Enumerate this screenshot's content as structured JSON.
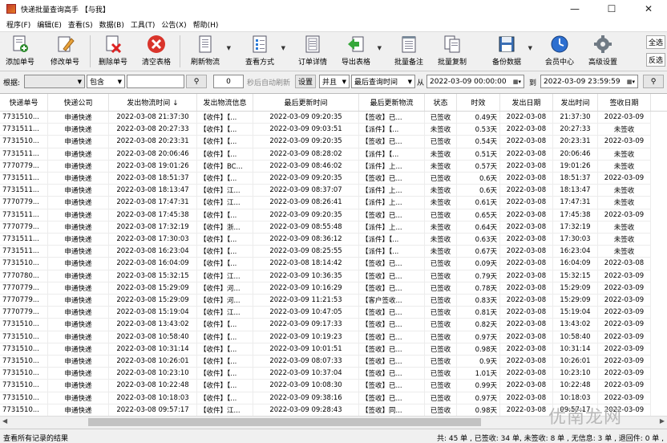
{
  "window": {
    "title": "快递批量查询高手 【与我】",
    "minimize": "—",
    "maximize": "☐",
    "close": "✕"
  },
  "menu": [
    "程序(F)",
    "编辑(E)",
    "查看(S)",
    "数据(B)",
    "工具(T)",
    "公告(X)",
    "帮助(H)"
  ],
  "toolbar": {
    "add": "添加单号",
    "edit": "修改单号",
    "delete": "删除单号",
    "clear": "清空表格",
    "refresh": "刷新物流",
    "view": "查看方式",
    "detail": "订单详情",
    "export": "导出表格",
    "remark": "批量备注",
    "copy": "批量复制",
    "backup": "备份数据",
    "member": "会员中心",
    "settings": "高级设置",
    "select_all": "全选",
    "invert": "反选"
  },
  "filter": {
    "by_label": "根据:",
    "by_value": "",
    "mode_value": "包含",
    "keyword": "",
    "interval": "0",
    "auto_refresh_label": "秒后自动刷新",
    "set_btn": "设置",
    "logic_value": "并且",
    "field_value": "最后查询时间",
    "from_label": "从",
    "from_value": "2022-03-09 00:00:00",
    "to_label": "到",
    "to_value": "2022-03-09 23:59:59"
  },
  "columns": [
    "快递单号",
    "快递公司",
    "发出物流时间 ↓",
    "发出物流信息",
    "最后更新时间",
    "最后更新物流",
    "状态",
    "时效",
    "发出日期",
    "发出时间",
    "签收日期"
  ],
  "rows": [
    [
      "7731510...",
      "申通快递",
      "2022-03-08 21:37:30",
      "【收件】【...",
      "2022-03-09 09:20:35",
      "【签收】已...",
      "已签收",
      "0.49天",
      "2022-03-08",
      "21:37:30",
      "2022-03-09"
    ],
    [
      "7731511...",
      "申通快递",
      "2022-03-08 20:27:33",
      "【收件】【...",
      "2022-03-09 09:03:51",
      "【派件】【...",
      "未签收",
      "0.53天",
      "2022-03-08",
      "20:27:33",
      "未签收"
    ],
    [
      "7731510...",
      "申通快递",
      "2022-03-08 20:23:31",
      "【收件】【...",
      "2022-03-09 09:20:35",
      "【签收】已...",
      "已签收",
      "0.54天",
      "2022-03-08",
      "20:23:31",
      "2022-03-09"
    ],
    [
      "7731511...",
      "申通快递",
      "2022-03-08 20:06:46",
      "【收件】【...",
      "2022-03-09 08:28:02",
      "【派件】【...",
      "未签收",
      "0.51天",
      "2022-03-08",
      "20:06:46",
      "未签收"
    ],
    [
      "7770779...",
      "申通快递",
      "2022-03-08 19:01:26",
      "【收件】BC...",
      "2022-03-09 08:46:02",
      "【派件】上...",
      "未签收",
      "0.57天",
      "2022-03-08",
      "19:01:26",
      "未签收"
    ],
    [
      "7731511...",
      "申通快递",
      "2022-03-08 18:51:37",
      "【收件】【...",
      "2022-03-09 09:20:35",
      "【签收】已...",
      "已签收",
      "0.6天",
      "2022-03-08",
      "18:51:37",
      "2022-03-09"
    ],
    [
      "7731511...",
      "申通快递",
      "2022-03-08 18:13:47",
      "【收件】江...",
      "2022-03-09 08:37:07",
      "【派件】上...",
      "未签收",
      "0.6天",
      "2022-03-08",
      "18:13:47",
      "未签收"
    ],
    [
      "7770779...",
      "申通快递",
      "2022-03-08 17:47:31",
      "【收件】江...",
      "2022-03-09 08:26:41",
      "【派件】上...",
      "未签收",
      "0.61天",
      "2022-03-08",
      "17:47:31",
      "未签收"
    ],
    [
      "7731511...",
      "申通快递",
      "2022-03-08 17:45:38",
      "【收件】【...",
      "2022-03-09 09:20:35",
      "【签收】已...",
      "已签收",
      "0.65天",
      "2022-03-08",
      "17:45:38",
      "2022-03-09"
    ],
    [
      "7770779...",
      "申通快递",
      "2022-03-08 17:32:19",
      "【收件】浙...",
      "2022-03-09 08:55:48",
      "【派件】上...",
      "未签收",
      "0.64天",
      "2022-03-08",
      "17:32:19",
      "未签收"
    ],
    [
      "7731511...",
      "申通快递",
      "2022-03-08 17:30:03",
      "【收件】【...",
      "2022-03-09 08:36:12",
      "【派件】【...",
      "未签收",
      "0.63天",
      "2022-03-08",
      "17:30:03",
      "未签收"
    ],
    [
      "7731511...",
      "申通快递",
      "2022-03-08 16:23:04",
      "【收件】【...",
      "2022-03-09 08:25:55",
      "【派件】【...",
      "未签收",
      "0.67天",
      "2022-03-08",
      "16:23:04",
      "未签收"
    ],
    [
      "7731510...",
      "申通快递",
      "2022-03-08 16:04:09",
      "【收件】【...",
      "2022-03-08 18:14:42",
      "【签收】已...",
      "已签收",
      "0.09天",
      "2022-03-08",
      "16:04:09",
      "2022-03-08"
    ],
    [
      "7770780...",
      "申通快递",
      "2022-03-08 15:32:15",
      "【收件】江...",
      "2022-03-09 10:36:35",
      "【签收】已...",
      "已签收",
      "0.79天",
      "2022-03-08",
      "15:32:15",
      "2022-03-09"
    ],
    [
      "7770779...",
      "申通快递",
      "2022-03-08 15:29:09",
      "【收件】河...",
      "2022-03-09 10:16:29",
      "【签收】已...",
      "已签收",
      "0.78天",
      "2022-03-08",
      "15:29:09",
      "2022-03-09"
    ],
    [
      "7770779...",
      "申通快递",
      "2022-03-08 15:29:09",
      "【收件】河...",
      "2022-03-09 11:21:53",
      "【客户签收...",
      "已签收",
      "0.83天",
      "2022-03-08",
      "15:29:09",
      "2022-03-09"
    ],
    [
      "7770779...",
      "申通快递",
      "2022-03-08 15:19:04",
      "【收件】江...",
      "2022-03-09 10:47:05",
      "【签收】已...",
      "已签收",
      "0.81天",
      "2022-03-08",
      "15:19:04",
      "2022-03-09"
    ],
    [
      "7731510...",
      "申通快递",
      "2022-03-08 13:43:02",
      "【收件】【...",
      "2022-03-09 09:17:33",
      "【签收】已...",
      "已签收",
      "0.82天",
      "2022-03-08",
      "13:43:02",
      "2022-03-09"
    ],
    [
      "7731510...",
      "申通快递",
      "2022-03-08 10:58:40",
      "【收件】【...",
      "2022-03-09 10:19:23",
      "【签收】已...",
      "已签收",
      "0.97天",
      "2022-03-08",
      "10:58:40",
      "2022-03-09"
    ],
    [
      "7731510...",
      "申通快递",
      "2022-03-08 10:31:14",
      "【收件】【...",
      "2022-03-09 10:01:51",
      "【签收】已...",
      "已签收",
      "0.98天",
      "2022-03-08",
      "10:31:14",
      "2022-03-09"
    ],
    [
      "7731510...",
      "申通快递",
      "2022-03-08 10:26:01",
      "【收件】【...",
      "2022-03-09 08:07:33",
      "【签收】已...",
      "已签收",
      "0.9天",
      "2022-03-08",
      "10:26:01",
      "2022-03-09"
    ],
    [
      "7731510...",
      "申通快递",
      "2022-03-08 10:23:10",
      "【收件】【...",
      "2022-03-09 10:37:04",
      "【签收】已...",
      "已签收",
      "1.01天",
      "2022-03-08",
      "10:23:10",
      "2022-03-09"
    ],
    [
      "7731510...",
      "申通快递",
      "2022-03-08 10:22:48",
      "【收件】【...",
      "2022-03-09 10:08:30",
      "【签收】已...",
      "已签收",
      "0.99天",
      "2022-03-08",
      "10:22:48",
      "2022-03-09"
    ],
    [
      "7731510...",
      "申通快递",
      "2022-03-08 10:18:03",
      "【收件】【...",
      "2022-03-09 09:38:16",
      "【签收】已...",
      "已签收",
      "0.97天",
      "2022-03-08",
      "10:18:03",
      "2022-03-09"
    ],
    [
      "7731510...",
      "申通快递",
      "2022-03-08 09:57:17",
      "【收件】江...",
      "2022-03-09 09:28:43",
      "【签收】同...",
      "已签收",
      "0.98天",
      "2022-03-08",
      "09:57:17",
      "2022-03-09"
    ]
  ],
  "status": {
    "message": "查看所有记录的结果",
    "summary": "共: 45 单 , 已签收: 34 单, 未签收: 8 单 , 无信息: 3 单 , 退回件: 0 单 ,"
  },
  "watermark": "优南龙网"
}
